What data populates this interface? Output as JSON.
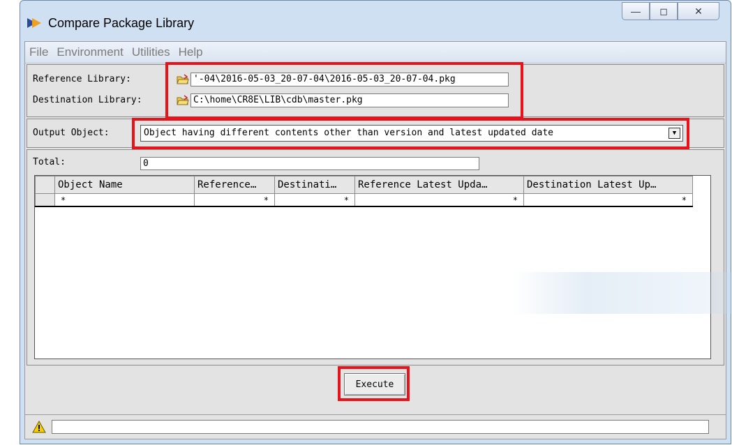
{
  "window": {
    "title": "Compare Package Library",
    "controls": {
      "minimize": "—",
      "maximize": "◻",
      "close": "✕"
    }
  },
  "menu": [
    "File",
    "Environment",
    "Utilities",
    "Help"
  ],
  "reference": {
    "label": "Reference Library:",
    "value": "'-04\\2016-05-03_20-07-04\\2016-05-03_20-07-04.pkg"
  },
  "destination": {
    "label": "Destination Library:",
    "value": "C:\\home\\CR8E\\LIB\\cdb\\master.pkg"
  },
  "output": {
    "label": "Output Object:",
    "selected": "Object having different contents other than version and latest updated date"
  },
  "total": {
    "label": "Total:",
    "value": "0"
  },
  "table": {
    "columns": [
      "Object Name",
      "Reference…",
      "Destinati…",
      "Reference Latest Upda…",
      "Destination Latest Up…"
    ],
    "new_row": [
      "*",
      "*",
      "*",
      "*",
      "*"
    ]
  },
  "execute_label": "Execute",
  "status_text": "",
  "colors": {
    "highlight": "#e8131a",
    "title_bg": "#cfe0f3",
    "client_bg": "#e3e3e3"
  }
}
